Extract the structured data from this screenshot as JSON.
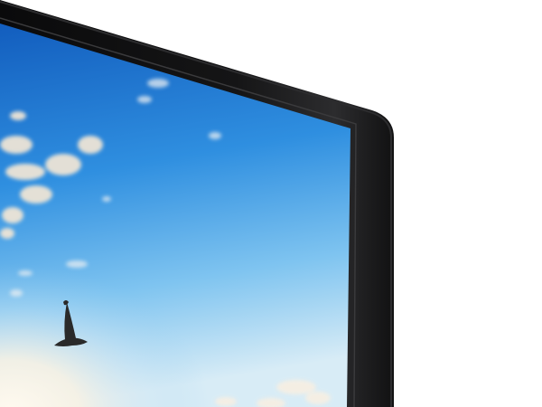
{
  "image": {
    "subject": "monitor-bezel-corner",
    "scene": [
      "monitor-frame",
      "screen-sky",
      "clouds",
      "flying-seagull",
      "sun-glow"
    ]
  },
  "colors": {
    "background": "#ffffff",
    "bezel_outer": "#0c0c0d",
    "bezel_highlight": "#2c2c2e",
    "bezel_inner_edge": "#3a3a3c",
    "sky_top": "#0e56b9",
    "sky_mid": "#2f8fe0",
    "sky_low": "#7fc4f0",
    "horizon_glow": "#f8f2e4",
    "cloud": "#f3e7d6",
    "bird": "#2a2a2a"
  }
}
